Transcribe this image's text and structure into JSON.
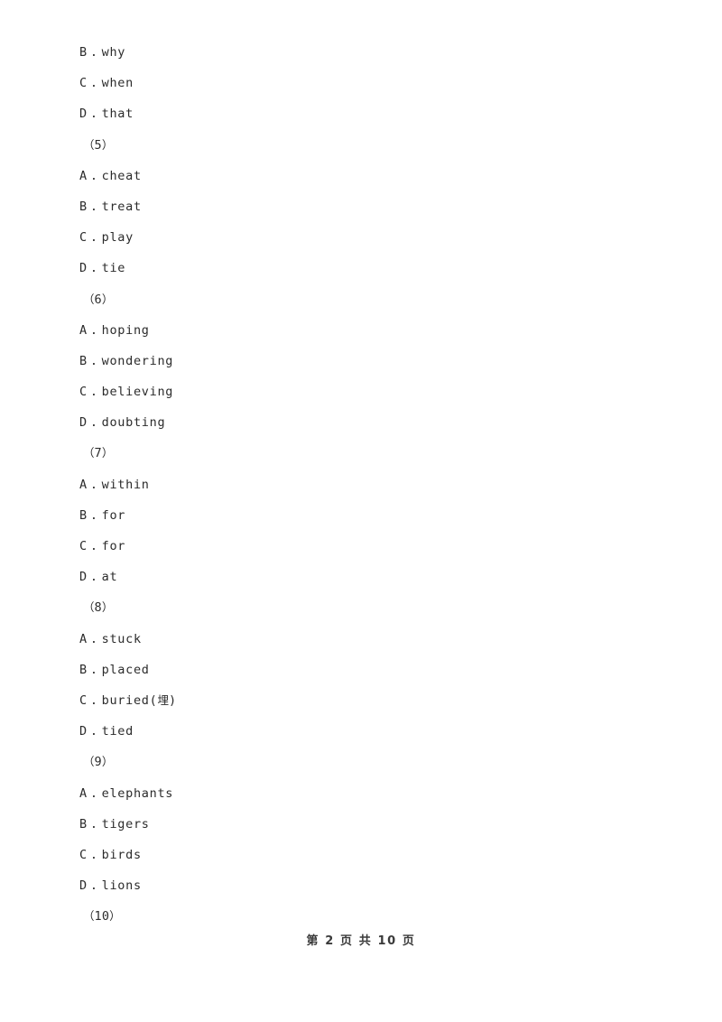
{
  "document": {
    "page_background": "#ffffff",
    "text_color": "#2b2b2b",
    "lines": [
      {
        "kind": "option",
        "letter": "B",
        "separator": ".",
        "text": "why"
      },
      {
        "kind": "option",
        "letter": "C",
        "separator": ".",
        "text": "when"
      },
      {
        "kind": "option",
        "letter": "D",
        "separator": ".",
        "text": "that"
      },
      {
        "kind": "question",
        "text": "（5）"
      },
      {
        "kind": "option",
        "letter": "A",
        "separator": ".",
        "text": "cheat"
      },
      {
        "kind": "option",
        "letter": "B",
        "separator": ".",
        "text": "treat"
      },
      {
        "kind": "option",
        "letter": "C",
        "separator": ".",
        "text": "play"
      },
      {
        "kind": "option",
        "letter": "D",
        "separator": ".",
        "text": "tie"
      },
      {
        "kind": "question",
        "text": "（6）"
      },
      {
        "kind": "option",
        "letter": "A",
        "separator": ".",
        "text": "hoping"
      },
      {
        "kind": "option",
        "letter": "B",
        "separator": ".",
        "text": "wondering"
      },
      {
        "kind": "option",
        "letter": "C",
        "separator": ".",
        "text": "believing"
      },
      {
        "kind": "option",
        "letter": "D",
        "separator": ".",
        "text": "doubting"
      },
      {
        "kind": "question",
        "text": "（7）"
      },
      {
        "kind": "option",
        "letter": "A",
        "separator": ".",
        "text": "within"
      },
      {
        "kind": "option",
        "letter": "B",
        "separator": ".",
        "text": "for"
      },
      {
        "kind": "option",
        "letter": "C",
        "separator": ".",
        "text": "for"
      },
      {
        "kind": "option",
        "letter": "D",
        "separator": ".",
        "text": "at"
      },
      {
        "kind": "question",
        "text": "（8）"
      },
      {
        "kind": "option",
        "letter": "A",
        "separator": ".",
        "text": "stuck"
      },
      {
        "kind": "option",
        "letter": "B",
        "separator": ".",
        "text": "placed"
      },
      {
        "kind": "option",
        "letter": "C",
        "separator": ".",
        "text": "buried(埋)"
      },
      {
        "kind": "option",
        "letter": "D",
        "separator": ".",
        "text": "tied"
      },
      {
        "kind": "question",
        "text": "（9）"
      },
      {
        "kind": "option",
        "letter": "A",
        "separator": ".",
        "text": "elephants"
      },
      {
        "kind": "option",
        "letter": "B",
        "separator": ".",
        "text": "tigers"
      },
      {
        "kind": "option",
        "letter": "C",
        "separator": ".",
        "text": "birds"
      },
      {
        "kind": "option",
        "letter": "D",
        "separator": ".",
        "text": "lions"
      },
      {
        "kind": "question",
        "text": "（10）"
      }
    ]
  },
  "footer": {
    "text": "第 2 页 共 10 页",
    "current_page": "2",
    "total_pages": "10"
  }
}
